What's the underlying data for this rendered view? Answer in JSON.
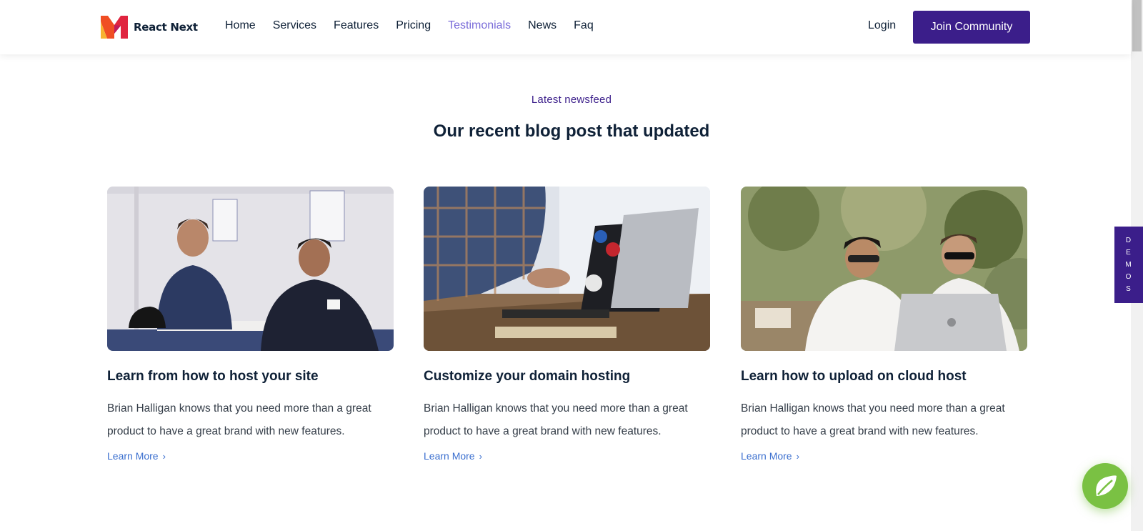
{
  "brand": {
    "name": "React Next",
    "accent": "#3b1e8a",
    "link_color": "#3b6fcf",
    "active_nav_color": "#7a6cd9"
  },
  "nav": {
    "items": [
      {
        "label": "Home",
        "active": false
      },
      {
        "label": "Services",
        "active": false
      },
      {
        "label": "Features",
        "active": false
      },
      {
        "label": "Pricing",
        "active": false
      },
      {
        "label": "Testimonials",
        "active": true
      },
      {
        "label": "News",
        "active": false
      },
      {
        "label": "Faq",
        "active": false
      }
    ],
    "login_label": "Login",
    "cta_label": "Join Community"
  },
  "section": {
    "eyebrow": "Latest newsfeed",
    "title": "Our recent blog post that updated"
  },
  "posts": [
    {
      "title": "Learn from how to host your site",
      "excerpt": "Brian Halligan knows that you need more than a great product to have a great brand with new features.",
      "link_label": "Learn More",
      "image": "two-men-at-table-photo"
    },
    {
      "title": "Customize your domain hosting",
      "excerpt": "Brian Halligan knows that you need more than a great product to have a great brand with new features.",
      "link_label": "Learn More",
      "image": "laptops-on-desk-photo"
    },
    {
      "title": "Learn how to upload on cloud host",
      "excerpt": "Brian Halligan knows that you need more than a great product to have a great brand with new features.",
      "link_label": "Learn More",
      "image": "two-men-with-laptop-photo"
    }
  ],
  "demos_tab": {
    "letters": [
      "D",
      "E",
      "M",
      "O",
      "S"
    ]
  },
  "chat": {
    "icon": "chat-leaf-icon",
    "color": "#7ac143"
  }
}
